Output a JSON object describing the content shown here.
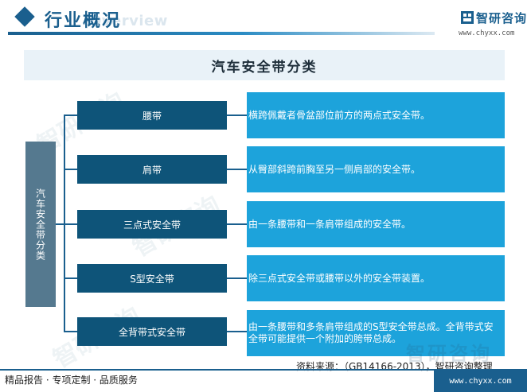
{
  "header": {
    "title": "行业概况",
    "watermark": "Overview",
    "logo_name": "智研咨询",
    "logo_url": "www.chyxx.com"
  },
  "banner": {
    "title": "汽车安全带分类"
  },
  "diagram": {
    "root": "汽车安全带分类",
    "categories": [
      {
        "name": "腰带",
        "description": "横跨佩戴者骨盆部位前方的两点式安全带。"
      },
      {
        "name": "肩带",
        "description": "从臀部斜跨前胸至另一侧肩部的安全带。"
      },
      {
        "name": "三点式安全带",
        "description": "由一条腰带和一条肩带组成的安全带。"
      },
      {
        "name": "S型安全带",
        "description": "除三点式安全带或腰带以外的安全带装置。"
      },
      {
        "name": "全背带式安全带",
        "description": "由一条腰带和多条肩带组成的S型安全带总成。全背带式安全带可能提供一个附加的胯带总成。"
      }
    ]
  },
  "watermarks": {
    "brand": "智研咨询"
  },
  "footer": {
    "source": "资料来源：（GB14166-2013），智研咨询整理",
    "left_text": "精品报告 · 专项定制 · 品质服务",
    "right_text": "www.chyxx.com"
  },
  "colors": {
    "brand_blue": "#1a5f8e",
    "category_box": "#0e5479",
    "description_box": "#1da3db",
    "root_box": "#55798f",
    "banner_bg": "#e9f2f8"
  }
}
